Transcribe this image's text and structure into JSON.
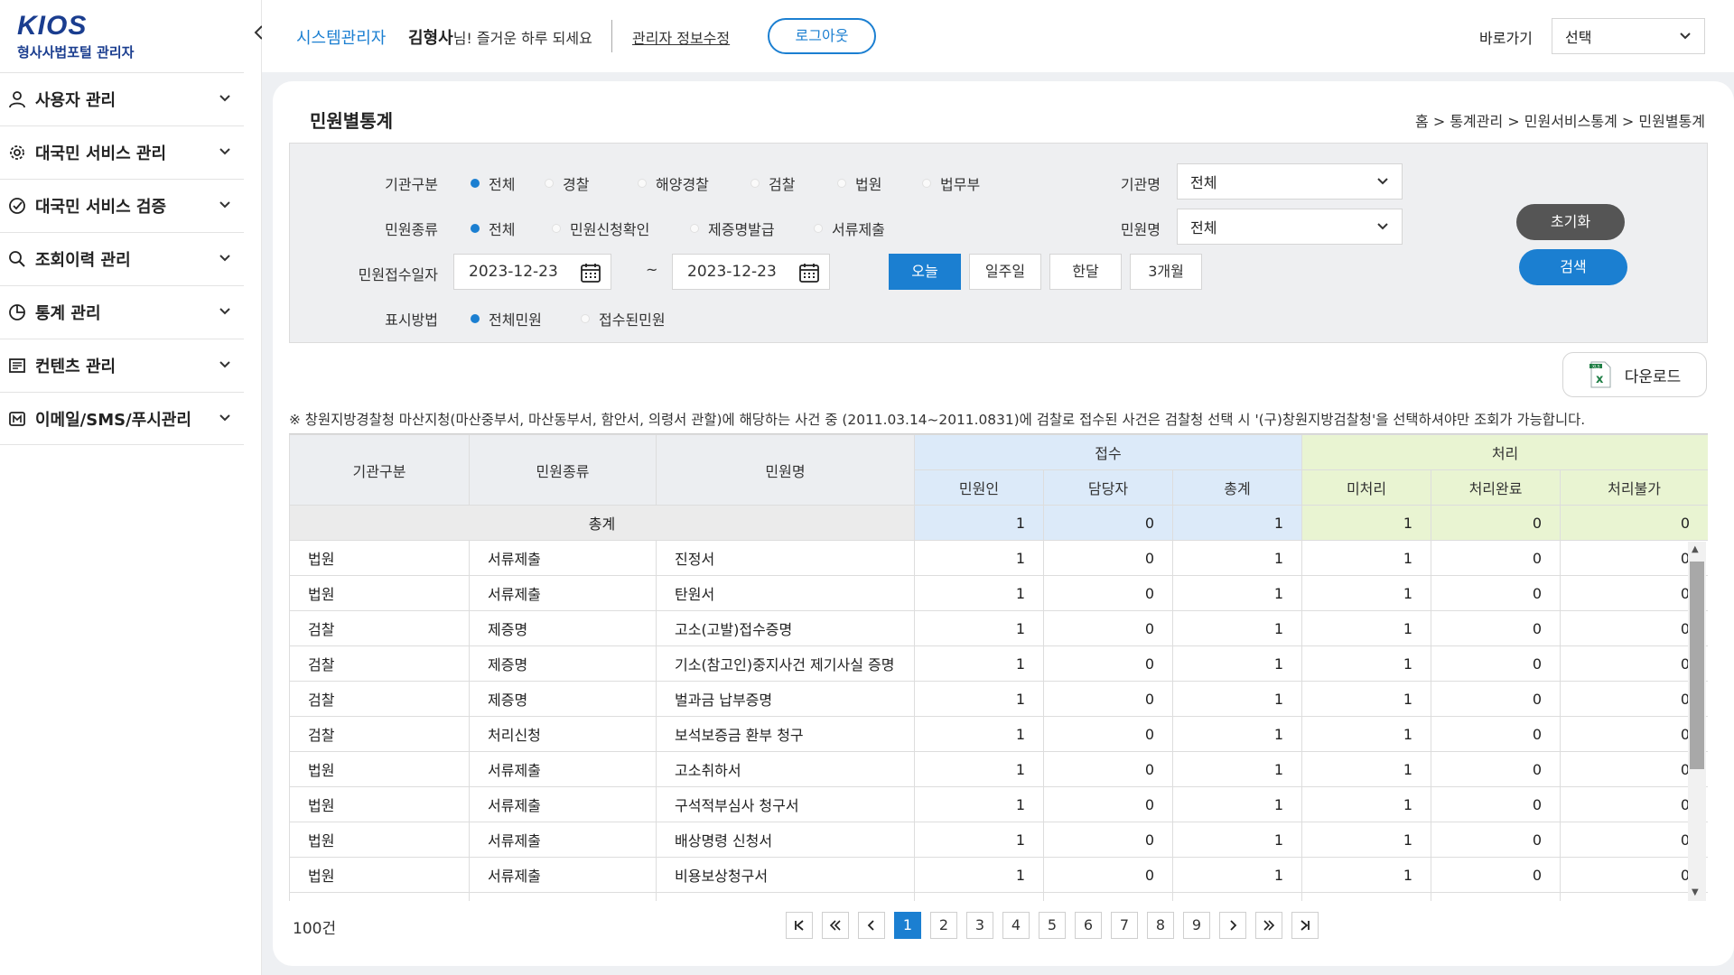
{
  "logo": {
    "mark": "KIOS",
    "sub": "형사사법포털 관리자"
  },
  "sidebar": {
    "items": [
      {
        "label": "사용자 관리",
        "icon": "user-icon"
      },
      {
        "label": "대국민 서비스 관리",
        "icon": "gear-icon"
      },
      {
        "label": "대국민 서비스 검증",
        "icon": "check-circle-icon"
      },
      {
        "label": "조회이력 관리",
        "icon": "search-icon"
      },
      {
        "label": "통계 관리",
        "icon": "pie-chart-icon"
      },
      {
        "label": "컨텐츠 관리",
        "icon": "document-icon"
      },
      {
        "label": "이메일/SMS/푸시관리",
        "icon": "mail-icon"
      }
    ]
  },
  "header": {
    "role": "시스템관리자",
    "user_name": "김형사",
    "user_greeting": "님! 즐거운 하루 되세요",
    "edit_link": "관리자 정보수정",
    "logout": "로그아웃",
    "goto_label": "바로가기",
    "goto_value": "선택"
  },
  "page": {
    "title": "민원별통계",
    "breadcrumb": "홈 > 통계관리  >  민원서비스통계  > 민원별통계"
  },
  "filter": {
    "org_label": "기관구분",
    "org_options": [
      "전체",
      "경찰",
      "해양경찰",
      "검찰",
      "법원",
      "법무부"
    ],
    "org_selected": 0,
    "org_name_label": "기관명",
    "org_name_value": "전체",
    "type_label": "민원종류",
    "type_options": [
      "전체",
      "민원신청확인",
      "제증명발급",
      "서류제출"
    ],
    "type_selected": 0,
    "civil_name_label": "민원명",
    "civil_name_value": "전체",
    "date_label": "민원접수일자",
    "date_from": "2023-12-23",
    "date_to": "2023-12-23",
    "tilde": "~",
    "periods": [
      "오늘",
      "일주일",
      "한달",
      "3개월"
    ],
    "period_selected": 0,
    "display_label": "표시방법",
    "display_options": [
      "전체민원",
      "접수된민원"
    ],
    "display_selected": 0,
    "reset": "초기화",
    "search": "검색",
    "reset_color": "#555555",
    "search_color": "#1b7fd1"
  },
  "download": "다운로드",
  "notice": "※ 창원지방경찰청 마산지청(마산중부서, 마산동부서, 함안서, 의령서 관할)에 해당하는 사건 중 (2011.03.14~2011.0831)에 검찰로 접수된 사건은 검찰청 선택 시 '(구)창원지방검찰청'을 선택하셔야만 조회가 가능합니다.",
  "table": {
    "headers": {
      "org": "기관구분",
      "type": "민원종류",
      "name": "민원명",
      "receipt": "접수",
      "receipt_cols": [
        "민원인",
        "담당자",
        "총계"
      ],
      "process": "처리",
      "process_cols": [
        "미처리",
        "처리완료",
        "처리불가"
      ]
    },
    "total": {
      "label": "총계",
      "values": [
        "1",
        "0",
        "1",
        "1",
        "0",
        "0"
      ]
    },
    "rows": [
      {
        "org": "법원",
        "type": "서류제출",
        "name": "진정서",
        "values": [
          "1",
          "0",
          "1",
          "1",
          "0",
          "0"
        ]
      },
      {
        "org": "법원",
        "type": "서류제출",
        "name": "탄원서",
        "values": [
          "1",
          "0",
          "1",
          "1",
          "0",
          "0"
        ]
      },
      {
        "org": "검찰",
        "type": "제증명",
        "name": "고소(고발)접수증명",
        "values": [
          "1",
          "0",
          "1",
          "1",
          "0",
          "0"
        ]
      },
      {
        "org": "검찰",
        "type": "제증명",
        "name": "기소(참고인)중지사건 제기사실 증명",
        "values": [
          "1",
          "0",
          "1",
          "1",
          "0",
          "0"
        ]
      },
      {
        "org": "검찰",
        "type": "제증명",
        "name": "벌과금 납부증명",
        "values": [
          "1",
          "0",
          "1",
          "1",
          "0",
          "0"
        ]
      },
      {
        "org": "검찰",
        "type": "처리신청",
        "name": "보석보증금 환부 청구",
        "values": [
          "1",
          "0",
          "1",
          "1",
          "0",
          "0"
        ]
      },
      {
        "org": "법원",
        "type": "서류제출",
        "name": "고소취하서",
        "values": [
          "1",
          "0",
          "1",
          "1",
          "0",
          "0"
        ]
      },
      {
        "org": "법원",
        "type": "서류제출",
        "name": "구석적부심사 청구서",
        "values": [
          "1",
          "0",
          "1",
          "1",
          "0",
          "0"
        ]
      },
      {
        "org": "법원",
        "type": "서류제출",
        "name": "배상명령 신청서",
        "values": [
          "1",
          "0",
          "1",
          "1",
          "0",
          "0"
        ]
      },
      {
        "org": "법원",
        "type": "서류제출",
        "name": "비용보상청구서",
        "values": [
          "1",
          "0",
          "1",
          "1",
          "0",
          "0"
        ]
      },
      {
        "org": "",
        "type": "",
        "name": "",
        "values": [
          "",
          "",
          "",
          "",
          "",
          ""
        ]
      }
    ]
  },
  "pagination": {
    "count": "100건",
    "pages": [
      "1",
      "2",
      "3",
      "4",
      "5",
      "6",
      "7",
      "8",
      "9"
    ],
    "current": 0
  }
}
